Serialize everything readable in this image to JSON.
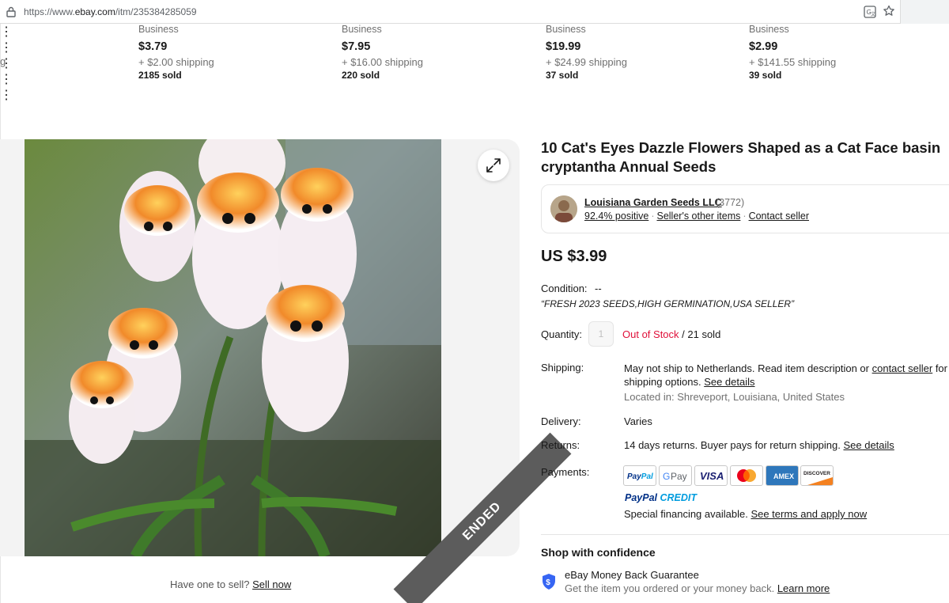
{
  "browser": {
    "url_prefix": "https://www.",
    "url_domain": "ebay.com",
    "url_path": "/itm/235384285059"
  },
  "carousel": {
    "partial_fragment": "g",
    "items": [
      {
        "type": "Business",
        "price": "$3.79",
        "shipping": "+ $2.00 shipping",
        "sold": "2185 sold"
      },
      {
        "type": "Business",
        "price": "$7.95",
        "shipping": "+ $16.00 shipping",
        "sold": "220 sold"
      },
      {
        "type": "Business",
        "price": "$19.99",
        "shipping": "+ $24.99 shipping",
        "sold": "37 sold"
      },
      {
        "type": "Business",
        "price": "$2.99",
        "shipping": "+ $141.55 shipping",
        "sold": "39 sold"
      }
    ],
    "more_icon": "⋮"
  },
  "gallery": {
    "ended_label": "ENDED",
    "sell_prompt": "Have one to sell?",
    "sell_link": "Sell now"
  },
  "listing": {
    "title": "10 Cat's Eyes Dazzle Flowers Shaped as a Cat Face basin cryptantha Annual Seeds",
    "price": "US $3.99",
    "condition_label": "Condition:",
    "condition_value": "--",
    "condition_note": "“FRESH 2023 SEEDS,HIGH GERMINATION,USA SELLER”",
    "quantity_label": "Quantity:",
    "quantity_value": "1",
    "stock_status": "Out of Stock",
    "sold_suffix": " / 21 sold"
  },
  "seller": {
    "name": "Louisiana Garden Seeds LLC",
    "feedback_count": "(3772)",
    "positive": "92.4% positive",
    "other_items": "Seller's other items",
    "contact": "Contact seller"
  },
  "shipping": {
    "label": "Shipping:",
    "text1": "May not ship to Netherlands. Read item description or ",
    "contact_link": "contact seller",
    "text2": " for",
    "text3": "shipping options. ",
    "details_link": "See details",
    "location": "Located in: Shreveport, Louisiana, United States"
  },
  "delivery": {
    "label": "Delivery:",
    "value": "Varies"
  },
  "returns": {
    "label": "Returns:",
    "value": "14 days returns. Buyer pays for return shipping. ",
    "details_link": "See details"
  },
  "payments": {
    "label": "Payments:",
    "methods": [
      "PayPal",
      "G Pay",
      "VISA",
      "Mastercard",
      "AMEX",
      "DISCOVER"
    ],
    "paypal_credit_a": "PayPal",
    "paypal_credit_b": " CREDIT",
    "financing_text": "Special financing available. ",
    "financing_link": "See terms and apply now"
  },
  "confidence": {
    "heading": "Shop with confidence",
    "guarantee_title": "eBay Money Back Guarantee",
    "guarantee_text": "Get the item you ordered or your money back. ",
    "learn_more": "Learn more"
  },
  "colors": {
    "accent_red": "#e0103a",
    "ended_banner": "#5c5c5c",
    "paypal_blue": "#003087",
    "shield_blue": "#3665f3"
  }
}
